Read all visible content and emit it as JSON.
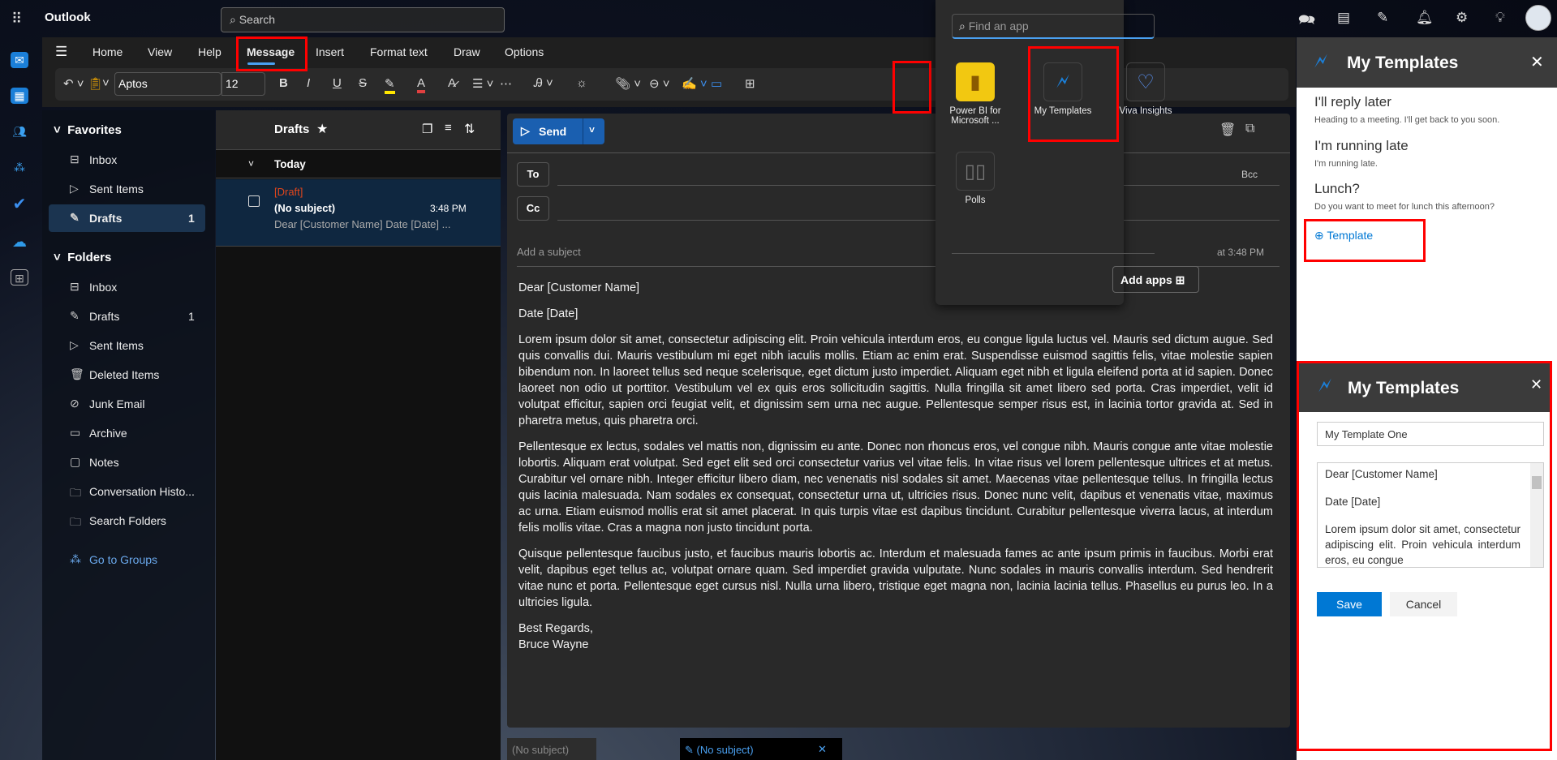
{
  "app": {
    "title": "Outlook",
    "search_placeholder": "Search"
  },
  "ribbon": {
    "tabs": [
      "Home",
      "View",
      "Help",
      "Message",
      "Insert",
      "Format text",
      "Draw",
      "Options"
    ],
    "active_tab": "Message",
    "font": "Aptos",
    "size": "12"
  },
  "nav": {
    "favorites": "Favorites",
    "fav_items": [
      {
        "label": "Inbox",
        "icon": "inbox-icon"
      },
      {
        "label": "Sent Items",
        "icon": "send-icon"
      },
      {
        "label": "Drafts",
        "icon": "drafts-icon",
        "count": "1"
      }
    ],
    "folders": "Folders",
    "folder_items": [
      {
        "label": "Inbox"
      },
      {
        "label": "Drafts",
        "count": "1"
      },
      {
        "label": "Sent Items"
      },
      {
        "label": "Deleted Items"
      },
      {
        "label": "Junk Email"
      },
      {
        "label": "Archive"
      },
      {
        "label": "Notes"
      },
      {
        "label": "Conversation Histo..."
      },
      {
        "label": "Search Folders"
      }
    ],
    "groups": "Go to Groups"
  },
  "list": {
    "title": "Drafts",
    "group": "Today",
    "item": {
      "tag": "[Draft]",
      "subject": "(No subject)",
      "time": "3:48 PM",
      "preview": "Dear [Customer Name] Date [Date] ..."
    }
  },
  "compose": {
    "send": "Send",
    "to": "To",
    "cc": "Cc",
    "bcc": "Bcc",
    "subject_placeholder": "Add a subject",
    "saved": "at 3:48 PM",
    "body": [
      "Dear [Customer Name]",
      "Date [Date]",
      "Lorem ipsum dolor sit amet, consectetur adipiscing elit. Proin vehicula interdum eros, eu congue ligula luctus vel. Mauris sed dictum augue. Sed quis convallis dui. Mauris vestibulum mi eget nibh iaculis mollis. Etiam ac enim erat. Suspendisse euismod sagittis felis, vitae molestie sapien bibendum non. In laoreet tellus sed neque scelerisque, eget dictum justo imperdiet. Aliquam eget nibh et ligula eleifend porta at id sapien. Donec laoreet non odio ut porttitor. Vestibulum vel ex quis eros sollicitudin sagittis. Nulla fringilla sit amet libero sed porta. Cras imperdiet, velit id volutpat efficitur, sapien orci feugiat velit, et dignissim sem urna nec augue. Pellentesque semper risus est, in lacinia tortor gravida at. Sed in pharetra metus, quis pharetra orci.",
      "Pellentesque ex lectus, sodales vel mattis non, dignissim eu ante. Donec non rhoncus eros, vel congue nibh. Mauris congue ante vitae molestie lobortis. Aliquam erat volutpat. Sed eget elit sed orci consectetur varius vel vitae felis. In vitae risus vel lorem pellentesque ultrices et at metus. Curabitur vel ornare nibh. Integer efficitur libero diam, nec venenatis nisl sodales sit amet. Maecenas vitae pellentesque tellus. In fringilla lectus quis lacinia malesuada. Nam sodales ex consequat, consectetur urna ut, ultricies risus. Donec nunc velit, dapibus et venenatis vitae, maximus ac urna. Etiam euismod mollis erat sit amet placerat. In quis turpis vitae est dapibus tincidunt. Curabitur pellentesque viverra lacus, at interdum felis mollis vitae. Cras a magna non justo tincidunt porta.",
      "Quisque pellentesque faucibus justo, et faucibus mauris lobortis ac. Interdum et malesuada fames ac ante ipsum primis in faucibus. Morbi erat velit, dapibus eget tellus ac, volutpat ornare quam. Sed imperdiet gravida vulputate. Nunc sodales in mauris convallis interdum. Sed hendrerit vitae nunc et porta. Pellentesque eget cursus nisl. Nulla urna libero, tristique eget magna non, lacinia lacinia tellus. Phasellus eu purus leo. In a ultricies ligula."
    ],
    "closing": "Best Regards,",
    "signature": "Bruce Wayne"
  },
  "bottom_tabs": [
    "(No subject)",
    "(No subject)"
  ],
  "apps_popup": {
    "search_placeholder": "Find an app",
    "apps": [
      "Power BI for Microsoft ...",
      "My Templates",
      "Viva Insights",
      "Polls"
    ],
    "add_apps": "Add apps"
  },
  "templates_panel": {
    "title": "My Templates",
    "items": [
      {
        "title": "I'll reply later",
        "text": "Heading to a meeting. I'll get back to you soon."
      },
      {
        "title": "I'm running late",
        "text": "I'm running late."
      },
      {
        "title": "Lunch?",
        "text": "Do you want to meet for lunch this afternoon?"
      }
    ],
    "add_label": "Template"
  },
  "template_editor": {
    "title": "My Templates",
    "name_value": "My Template One",
    "content": [
      "Dear [Customer Name]",
      "Date [Date]",
      "Lorem ipsum dolor sit amet, consectetur adipiscing elit. Proin vehicula interdum eros, eu congue"
    ],
    "save": "Save",
    "cancel": "Cancel"
  },
  "colors": {
    "accent": "#0078d4",
    "highlight": "#ff0000",
    "draft_tag": "#e0461c"
  }
}
